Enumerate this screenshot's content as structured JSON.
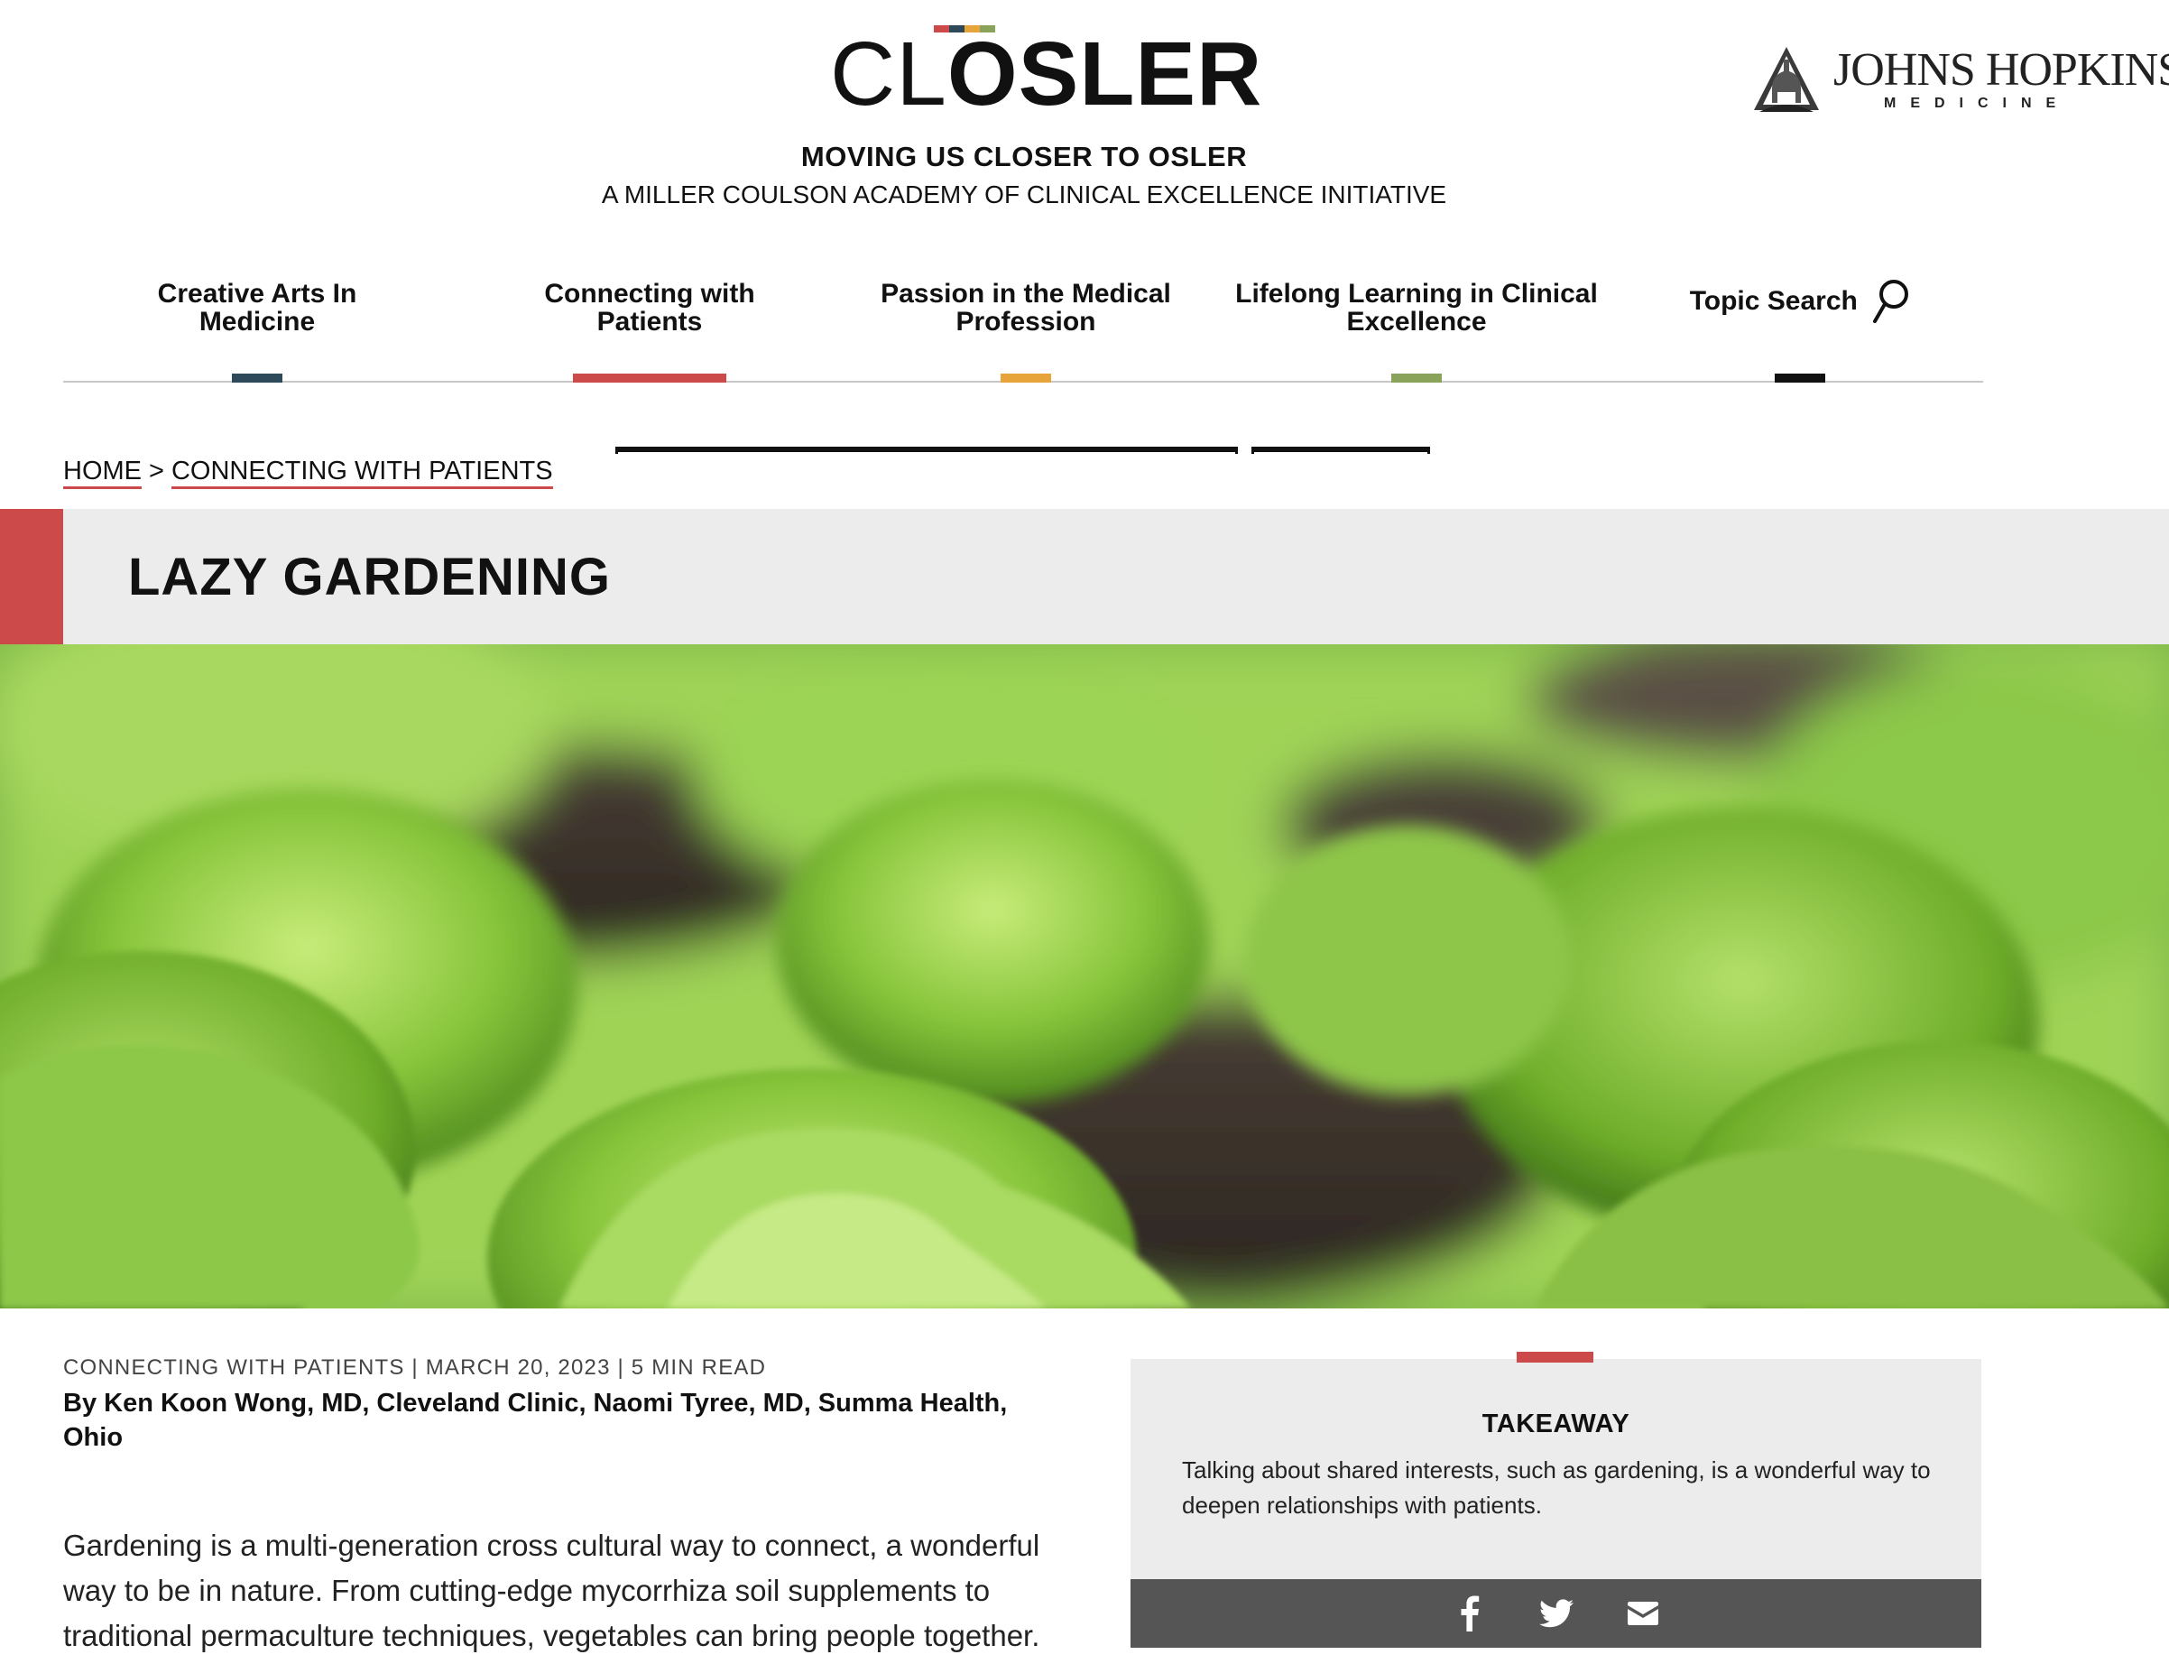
{
  "site": {
    "logo_text_light": "CL",
    "logo_text_bold": "OSLER",
    "logo_stripe_colors": [
      "#cc4a4a",
      "#2e4a5a",
      "#e6a43a",
      "#8aa35a"
    ],
    "tagline": "MOVING US CLOSER TO OSLER",
    "subtagline": "A MILLER COULSON ACADEMY OF CLINICAL EXCELLENCE INITIATIVE",
    "partner_name": "JOHNS HOPKINS",
    "partner_sub": "MEDICINE"
  },
  "nav": {
    "items": [
      {
        "label": "Creative Arts In Medicine",
        "color": "#2e4a5a"
      },
      {
        "label": "Connecting with Patients",
        "color": "#cc4a4a"
      },
      {
        "label": "Passion in the Medical Profession",
        "color": "#e6a43a"
      },
      {
        "label": "Lifelong Learning in Clinical Excellence",
        "color": "#8aa35a"
      },
      {
        "label": "Topic Search",
        "color": "#111111",
        "icon": "search-icon"
      }
    ]
  },
  "breadcrumb": {
    "home": "HOME",
    "separator": ">",
    "current": "CONNECTING WITH PATIENTS"
  },
  "article": {
    "title": "LAZY GARDENING",
    "accent_color": "#cc4a4a",
    "hero_image": "lettuce-garden-photo",
    "meta": "CONNECTING WITH PATIENTS | MARCH 20, 2023 | 5 MIN READ",
    "byline": "By Ken Koon Wong, MD, Cleveland Clinic, Naomi Tyree, MD, Summa Health, Ohio",
    "lede": "Gardening is a multi-generation cross cultural way to connect, a wonderful way to be in nature. From cutting-edge mycorrhiza soil supplements to traditional permaculture techniques, vegetables can bring people together."
  },
  "takeaway": {
    "title": "TAKEAWAY",
    "text": "Talking about shared interests, such as gardening, is a wonderful way to deepen relationships with patients.",
    "share_icons": [
      "facebook-icon",
      "twitter-icon",
      "email-icon"
    ]
  }
}
